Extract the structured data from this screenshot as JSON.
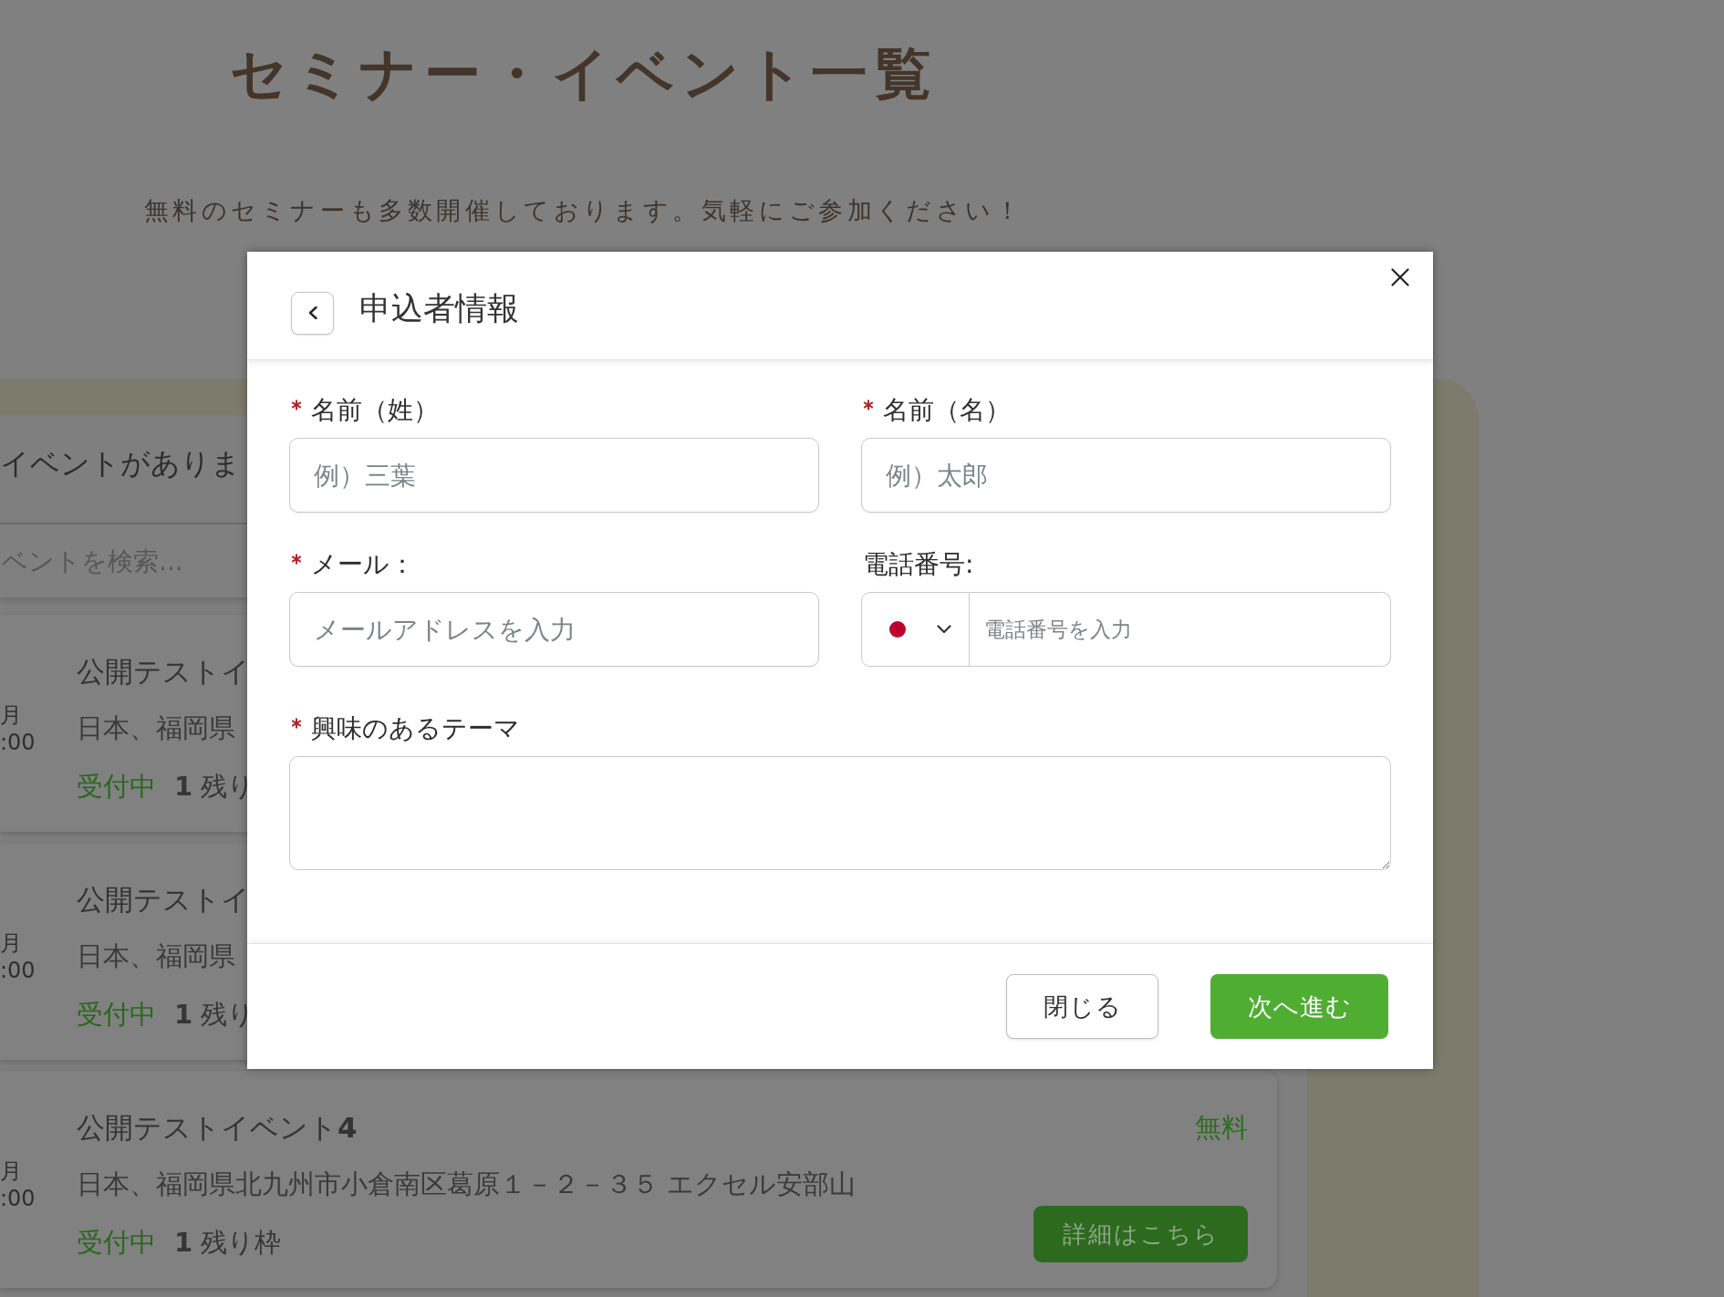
{
  "page": {
    "title": "セミナー・イベント一覧",
    "subtitle": "無料のセミナーも多数開催しております。気軽にご参加ください！"
  },
  "event_list": {
    "heading": "イベントがありま",
    "search": {
      "placeholder": "ベントを検索..."
    },
    "events": [
      {
        "date": "月",
        "time": ":00",
        "title": "公開テストイ",
        "address": "日本、福岡県",
        "status": "受付中",
        "availability": "**1** 残り"
      },
      {
        "date": "月",
        "time": ":00",
        "title": "公開テストイ",
        "address": "日本、福岡県",
        "status": "受付中",
        "availability": "**1** 残り"
      },
      {
        "date": "月",
        "time": ":00",
        "title": "公開テストイベント**4**",
        "price": "無料",
        "address": "日本、福岡県北九州市小倉南区葛原１－２－３５ エクセル安部山",
        "status": "受付中",
        "availability": "**1** 残り枠",
        "button": "詳細はこちら"
      }
    ]
  },
  "modal": {
    "title": "申込者情報",
    "fields": [
      {
        "kind": "text",
        "label": "名前（姓）",
        "required": true,
        "placeholder": "例）三葉"
      },
      {
        "kind": "text",
        "label": "名前（名）",
        "required": true,
        "placeholder": "例）太郎"
      },
      {
        "kind": "text",
        "label": "メール：",
        "required": true,
        "placeholder": "メールアドレスを入力"
      },
      {
        "kind": "phone",
        "label": "電話番号:",
        "required": false,
        "placeholder": "電話番号を入力"
      },
      {
        "kind": "textarea",
        "label": "興味のあるテーマ",
        "required": true
      }
    ],
    "buttons": [
      {
        "kind": "secondary",
        "label": "閉じる"
      },
      {
        "kind": "primary",
        "label": "次へ進む"
      }
    ]
  }
}
